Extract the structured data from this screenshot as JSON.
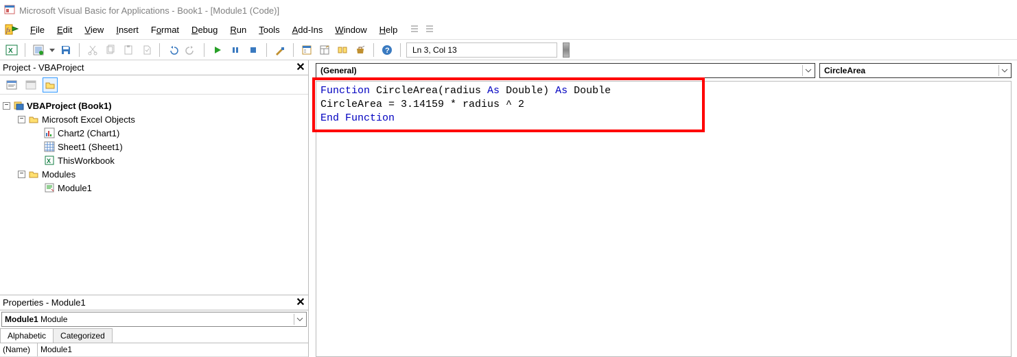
{
  "title": "Microsoft Visual Basic for Applications - Book1 - [Module1 (Code)]",
  "menu": {
    "file": "File",
    "edit": "Edit",
    "view": "View",
    "insert": "Insert",
    "format": "Format",
    "debug": "Debug",
    "run": "Run",
    "tools": "Tools",
    "addins": "Add-Ins",
    "window": "Window",
    "help": "Help"
  },
  "toolbar": {
    "cursor_position": "Ln 3, Col 13"
  },
  "project_pane": {
    "title": "Project - VBAProject",
    "root": "VBAProject (Book1)",
    "excel_objects": "Microsoft Excel Objects",
    "chart": "Chart2 (Chart1)",
    "sheet": "Sheet1 (Sheet1)",
    "workbook": "ThisWorkbook",
    "modules": "Modules",
    "module1": "Module1"
  },
  "properties_pane": {
    "title": "Properties - Module1",
    "combo_name": "Module1",
    "combo_type": "Module",
    "tab_alpha": "Alphabetic",
    "tab_cat": "Categorized",
    "prop_name_label": "(Name)",
    "prop_name_value": "Module1"
  },
  "code": {
    "object_combo": "(General)",
    "proc_combo": "CircleArea",
    "line1_pre": "Function",
    "line1_mid": " CircleArea(radius ",
    "line1_as1": "As",
    "line1_t1": " Double",
    "line1_paren": ") ",
    "line1_as2": "As",
    "line1_t2": " Double",
    "line2": "CircleArea = 3.14159 * radius ^ 2",
    "line3": "End Function"
  }
}
